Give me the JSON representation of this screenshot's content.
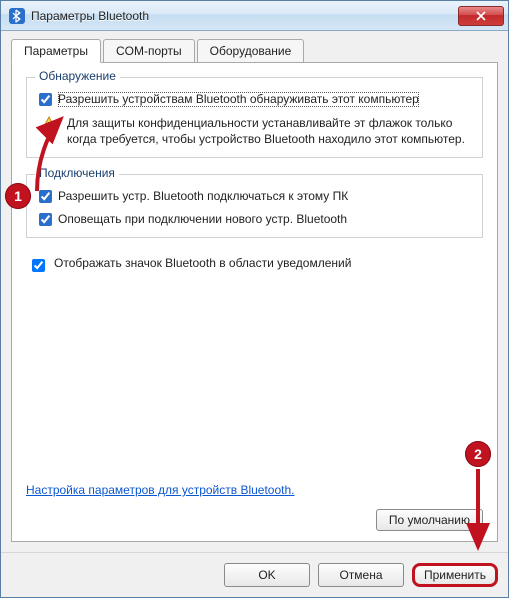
{
  "window": {
    "title": "Параметры Bluetooth"
  },
  "tabs": {
    "t0": "Параметры",
    "t1": "COM-порты",
    "t2": "Оборудование"
  },
  "discovery": {
    "legend": "Обнаружение",
    "allow_label": "Разрешить устройствам Bluetooth обнаруживать этот компьютер",
    "warn_text": "Для защиты конфиденциальности устанавливайте эт флажок только когда требуется, чтобы устройство Bluetooth находило этот компьютер."
  },
  "connections": {
    "legend": "Подключения",
    "allow_connect": "Разрешить устр. Bluetooth подключаться к этому ПК",
    "notify_new": "Оповещать при подключении нового устр. Bluetooth"
  },
  "tray": {
    "show_icon": "Отображать значок Bluetooth в области уведомлений"
  },
  "link": {
    "device_settings": "Настройка параметров для устройств Bluetooth."
  },
  "buttons": {
    "defaults": "По умолчанию",
    "ok": "OK",
    "cancel": "Отмена",
    "apply": "Применить"
  },
  "annotations": {
    "b1": "1",
    "b2": "2"
  }
}
